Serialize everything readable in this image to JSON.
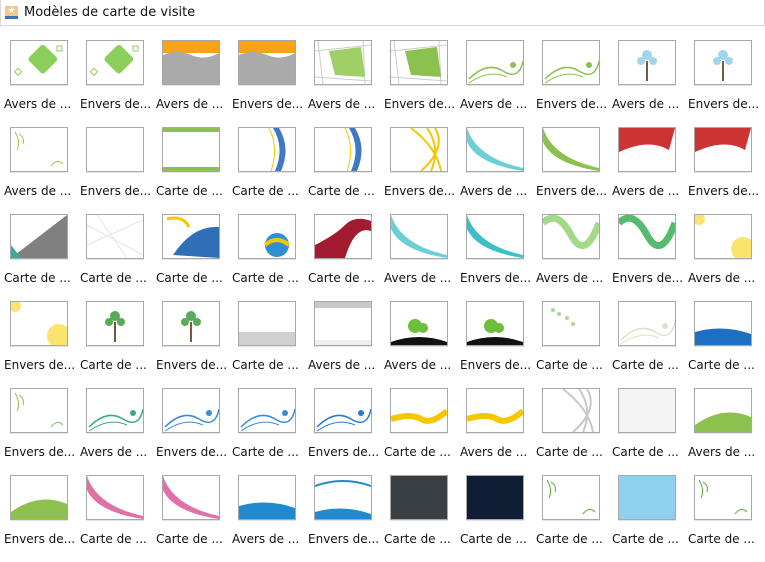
{
  "window": {
    "title": "Modèles de carte de visite",
    "icon": "template-icon"
  },
  "items": [
    {
      "label": "Avers de ...",
      "art": "diamond",
      "c": "#8cce5a"
    },
    {
      "label": "Envers de...",
      "art": "diamond",
      "c": "#8cce5a"
    },
    {
      "label": "Avers de ...",
      "art": "orangewave",
      "c": "#f7a21b"
    },
    {
      "label": "Envers de...",
      "art": "orangewave",
      "c": "#f7a21b"
    },
    {
      "label": "Avers de ...",
      "art": "quad",
      "c": "#9fd067"
    },
    {
      "label": "Envers de...",
      "art": "quad",
      "c": "#8cc04f"
    },
    {
      "label": "Avers de ...",
      "art": "vine",
      "c": "#8cc04f"
    },
    {
      "label": "Envers de...",
      "art": "vine",
      "c": "#8cc04f"
    },
    {
      "label": "Avers de ...",
      "art": "tree",
      "c": "#9fd6ec"
    },
    {
      "label": "Envers de...",
      "art": "tree",
      "c": "#9fd6ec"
    },
    {
      "label": "Avers de ...",
      "art": "corner",
      "c": "#9cc74f"
    },
    {
      "label": "Envers de...",
      "art": "blank",
      "c": "#ffffff"
    },
    {
      "label": "Carte de ...",
      "art": "scallop",
      "c": "#8cc04f"
    },
    {
      "label": "Carte de ...",
      "art": "stripe",
      "c": "#3f78c4"
    },
    {
      "label": "Carte de ...",
      "art": "stripe",
      "c": "#3f78c4"
    },
    {
      "label": "Envers de...",
      "art": "curves",
      "c": "#f6c700"
    },
    {
      "label": "Avers de ...",
      "art": "sweep",
      "c": "#6dcfd6"
    },
    {
      "label": "Envers de...",
      "art": "sweep",
      "c": "#8cc04f"
    },
    {
      "label": "Avers de ...",
      "art": "ribbon",
      "c": "#cc3333"
    },
    {
      "label": "Envers de...",
      "art": "ribbon",
      "c": "#cc3333"
    },
    {
      "label": "Carte de ...",
      "art": "triangle",
      "c": "#808080"
    },
    {
      "label": "Carte de ...",
      "art": "lines",
      "c": "#e4e4e4"
    },
    {
      "label": "Carte de ...",
      "art": "swoosh",
      "c": "#2f6fb8"
    },
    {
      "label": "Carte de ...",
      "art": "ball",
      "c": "#2f8fd0"
    },
    {
      "label": "Carte de ...",
      "art": "swirl",
      "c": "#a31b30"
    },
    {
      "label": "Avers de ...",
      "art": "sweep",
      "c": "#6dcfd6"
    },
    {
      "label": "Envers de...",
      "art": "sweep",
      "c": "#3cbfc8"
    },
    {
      "label": "Avers de ...",
      "art": "sine",
      "c": "#8cd06a"
    },
    {
      "label": "Envers de...",
      "art": "sine",
      "c": "#2aaa4a"
    },
    {
      "label": "Avers de ...",
      "art": "flower",
      "c": "#fbe46e"
    },
    {
      "label": "Envers de...",
      "art": "flower",
      "c": "#fbe46e"
    },
    {
      "label": "Carte de ...",
      "art": "tree",
      "c": "#5aaa5a"
    },
    {
      "label": "Envers de...",
      "art": "tree",
      "c": "#5aaa5a"
    },
    {
      "label": "Carte de ...",
      "art": "bottomband",
      "c": "#d0d0d0"
    },
    {
      "label": "Avers de ...",
      "art": "topband",
      "c": "#c8c8c8"
    },
    {
      "label": "Avers de ...",
      "art": "hilltree",
      "c": "#6cbf3a"
    },
    {
      "label": "Envers de...",
      "art": "hilltree",
      "c": "#6cbf3a"
    },
    {
      "label": "Carte de ...",
      "art": "dots",
      "c": "#a8d898"
    },
    {
      "label": "Carte de ...",
      "art": "vine",
      "c": "#e0e0c8"
    },
    {
      "label": "Carte de ...",
      "art": "sea",
      "c": "#1f6fc0"
    },
    {
      "label": "Envers de...",
      "art": "corner",
      "c": "#8cc04f"
    },
    {
      "label": "Avers de ...",
      "art": "vine",
      "c": "#3aaa7a"
    },
    {
      "label": "Envers de...",
      "art": "vine",
      "c": "#3a8ad0"
    },
    {
      "label": "Carte de ...",
      "art": "vine",
      "c": "#3a8ad0"
    },
    {
      "label": "Envers de...",
      "art": "vine",
      "c": "#2a7ad0"
    },
    {
      "label": "Carte de ...",
      "art": "yellowwave",
      "c": "#f6c700"
    },
    {
      "label": "Avers de ...",
      "art": "yellowwave",
      "c": "#f6c700"
    },
    {
      "label": "Carte de ...",
      "art": "curves",
      "c": "#c8c8c8"
    },
    {
      "label": "Carte de ...",
      "art": "blank",
      "c": "#f4f4f4"
    },
    {
      "label": "Avers de ...",
      "art": "hill",
      "c": "#8cc04f"
    },
    {
      "label": "Envers de...",
      "art": "hill",
      "c": "#8cc04f"
    },
    {
      "label": "Carte de ...",
      "art": "sweep",
      "c": "#e070a8"
    },
    {
      "label": "Carte de ...",
      "art": "sweep",
      "c": "#e070a8"
    },
    {
      "label": "Avers de ...",
      "art": "sea",
      "c": "#1f8ad0"
    },
    {
      "label": "Envers de...",
      "art": "bluewave",
      "c": "#1f8ad0"
    },
    {
      "label": "Carte de ...",
      "art": "solid",
      "c": "#3a3f44"
    },
    {
      "label": "Carte de ...",
      "art": "solid",
      "c": "#0f1e35"
    },
    {
      "label": "Carte de ...",
      "art": "corner",
      "c": "#5aaa3a"
    },
    {
      "label": "Carte de ...",
      "art": "solid",
      "c": "#8fd0f0"
    },
    {
      "label": "Carte de ...",
      "art": "corner",
      "c": "#5aaa3a"
    }
  ]
}
